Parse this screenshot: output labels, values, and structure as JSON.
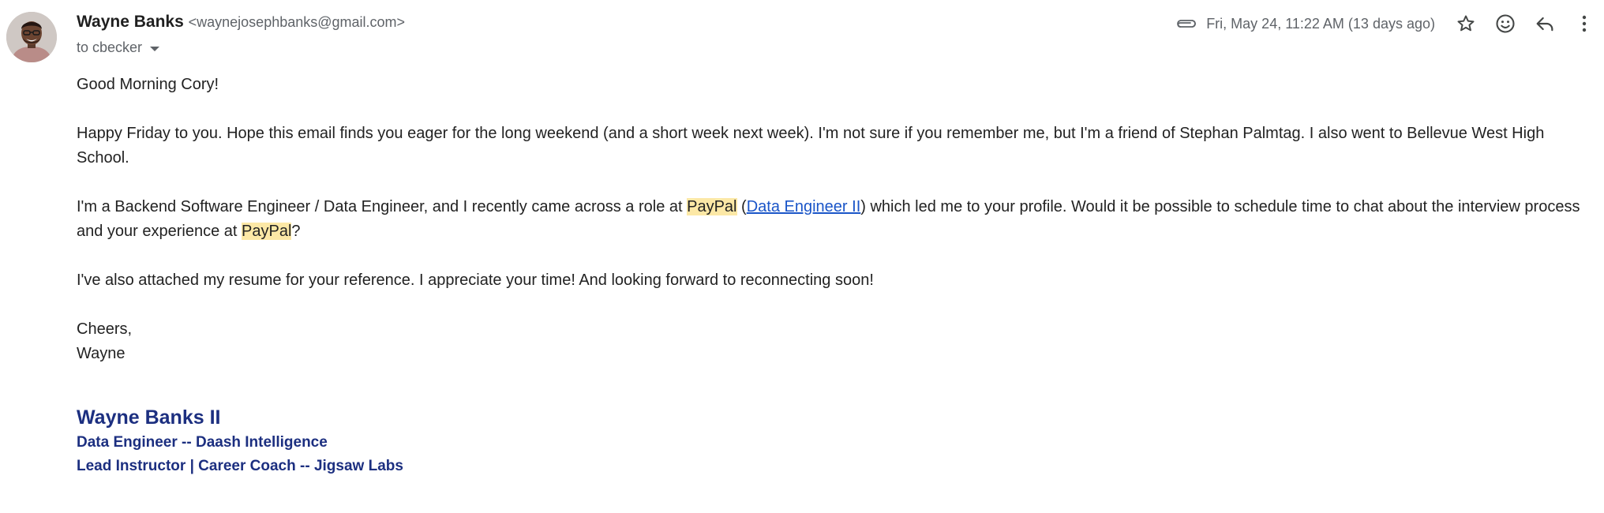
{
  "sender": {
    "name": "Wayne Banks",
    "email": "<waynejosephbanks@gmail.com>",
    "recipient_label": "to cbecker"
  },
  "header": {
    "date": "Fri, May 24, 11:22 AM (13 days ago)",
    "icons": [
      "attachment-icon",
      "star-icon",
      "emoji-icon",
      "reply-icon",
      "more-vert-icon"
    ]
  },
  "body": {
    "greeting": "Good Morning Cory!",
    "paragraph1": "Happy Friday to you. Hope this email finds you eager for the long weekend (and a short week next week). I'm not sure if you remember me, but I'm a friend of Stephan Palmtag. I also went to Bellevue West High School.",
    "paragraph2": {
      "part1": "I'm a Backend Software Engineer / Data Engineer, and I recently came across a role at ",
      "highlight1": "PayPal",
      "part2": " (",
      "link": "Data Engineer II",
      "part3": ") which led me to your profile. Would it be possible to schedule time to chat about the interview process and your experience at ",
      "highlight2": "PayPal",
      "part4": "?"
    },
    "paragraph3": "I've also attached my resume for your reference. I appreciate your time! And looking forward to reconnecting soon!",
    "closing": "Cheers,",
    "signoff": "Wayne"
  },
  "signature": {
    "name": "Wayne Banks II",
    "line1": "Data Engineer -- Daash Intelligence",
    "line2": "Lead Instructor | Career Coach -- Jigsaw Labs"
  },
  "colors": {
    "highlight": "#fce8a6",
    "link": "#1a55c8",
    "signature": "#1c2f80",
    "muted": "#5f6368"
  }
}
